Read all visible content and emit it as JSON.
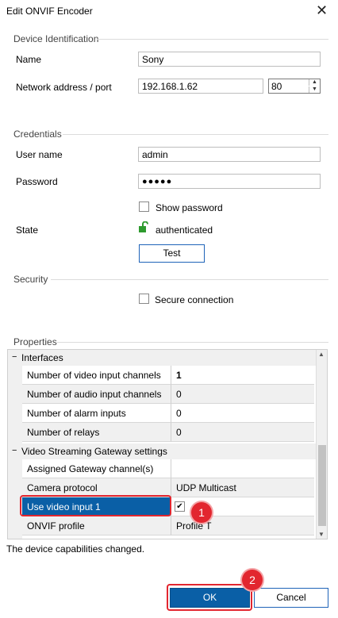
{
  "window": {
    "title": "Edit ONVIF Encoder",
    "close_icon": "close-icon"
  },
  "device_identification": {
    "group_title": "Device Identification",
    "name_label": "Name",
    "name_value": "Sony",
    "network_label": "Network address / port",
    "network_value": "192.168.1.62",
    "port_value": "80"
  },
  "credentials": {
    "group_title": "Credentials",
    "user_label": "User name",
    "user_value": "admin",
    "password_label": "Password",
    "password_value": "●●●●●",
    "show_password_label": "Show password",
    "state_label": "State",
    "state_value": "authenticated",
    "test_button": "Test"
  },
  "security": {
    "group_title": "Security",
    "secure_connection_label": "Secure connection"
  },
  "properties": {
    "group_title": "Properties",
    "categories": [
      {
        "title": "Interfaces",
        "toggle": "−",
        "rows": [
          {
            "label": "Number of video input channels",
            "value": "1"
          },
          {
            "label": "Number of audio input channels",
            "value": "0"
          },
          {
            "label": "Number of alarm inputs",
            "value": "0"
          },
          {
            "label": "Number of relays",
            "value": "0"
          }
        ]
      },
      {
        "title": "Video Streaming Gateway settings",
        "toggle": "−",
        "rows": [
          {
            "label": "Assigned Gateway channel(s)",
            "value": ""
          },
          {
            "label": "Camera protocol",
            "value": "UDP Multicast"
          },
          {
            "label": "Use video input 1",
            "value": "✔"
          },
          {
            "label": "ONVIF profile",
            "value": "Profile T"
          }
        ]
      }
    ]
  },
  "status_message": "The device capabilities changed.",
  "buttons": {
    "ok": "OK",
    "cancel": "Cancel"
  },
  "annotations": {
    "badge1": "1",
    "badge2": "2"
  },
  "colors": {
    "accent": "#0a5fa6",
    "highlight_red": "#e2262f",
    "lock_green": "#2e9a2e"
  }
}
